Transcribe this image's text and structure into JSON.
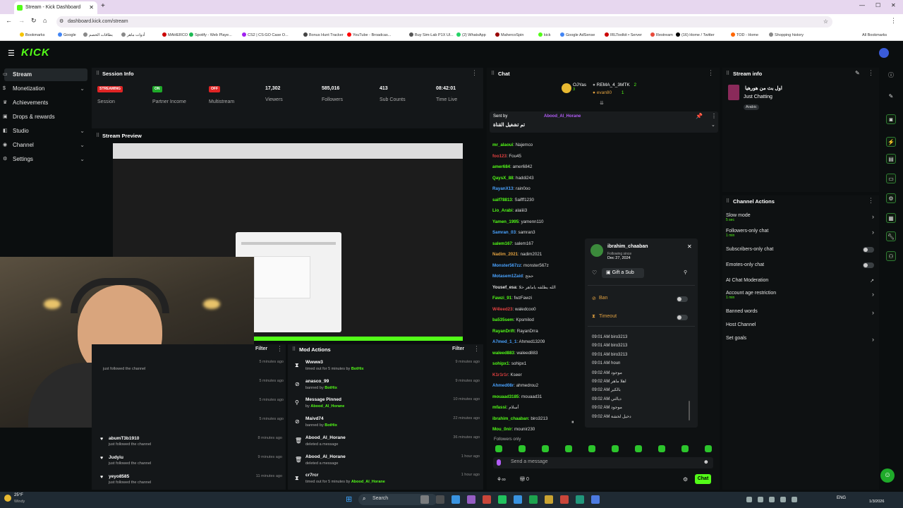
{
  "browser": {
    "tab_title": "Stream - Kick Dashboard",
    "url": "dashboard.kick.com/stream",
    "bookmarks": [
      "Bookmarks",
      "Google",
      "بطاقات الخصم",
      "أدوات ماهر",
      "MAHERCO",
      "Spotify - Web Playe...",
      "CS2 | CS:GO Case O...",
      "Bonus Hunt Tracker",
      "YouTube - Broadcas...",
      "Buy Sim-Lab P1X Ul...",
      "(2) WhatsApp",
      "MahercoSpin",
      "kick",
      "Google AdSense",
      "IRLToolkit • Server",
      "Restream",
      "(16) Home / Twitter",
      "TOD - Home",
      "Shopping history"
    ],
    "all_bookmarks": "All Bookmarks"
  },
  "brand": {
    "logo": "KICK",
    "accent": "#53fc18"
  },
  "sidebar": {
    "items": [
      {
        "label": "Stream",
        "active": true,
        "icon": "stream-icon",
        "chevron": false
      },
      {
        "label": "Monetization",
        "chevron": true,
        "icon": "dollar-icon"
      },
      {
        "label": "Achievements",
        "chevron": false,
        "icon": "trophy-icon"
      },
      {
        "label": "Drops & rewards",
        "chevron": false,
        "icon": "gift-icon"
      },
      {
        "label": "Studio",
        "chevron": true,
        "icon": "studio-icon"
      },
      {
        "label": "Channel",
        "chevron": true,
        "icon": "channel-icon"
      },
      {
        "label": "Settings",
        "chevron": true,
        "icon": "gear-icon"
      }
    ]
  },
  "session_info": {
    "title": "Session Info",
    "stats": [
      {
        "badge": "STREAMING",
        "badge_color": "#e02424",
        "label": "Session"
      },
      {
        "badge": "ON",
        "badge_color": "#1faa2a",
        "label": "Partner Income"
      },
      {
        "badge": "OFF",
        "badge_color": "#e02424",
        "label": "Multistream"
      },
      {
        "value": "17,302",
        "label": "Viewers"
      },
      {
        "value": "585,016",
        "label": "Followers"
      },
      {
        "value": "413",
        "label": "Sub Counts"
      },
      {
        "value": "08:42:01",
        "label": "Time Live"
      }
    ]
  },
  "stream_preview": {
    "title": "Stream Preview"
  },
  "activity_feed": {
    "filter": "Filter",
    "rows": [
      {
        "name": "",
        "sub": "just followed the channel",
        "time": "5 minutes ago"
      },
      {
        "name": "",
        "sub": "",
        "time": "5 minutes ago"
      },
      {
        "name": "",
        "sub": "",
        "time": "5 minutes ago"
      },
      {
        "name": "",
        "sub": "",
        "time": "5 minutes ago"
      },
      {
        "name": "abumT3b1910",
        "sub": "just followed the channel",
        "time": "8 minutes ago"
      },
      {
        "name": "Judyiu",
        "sub": "just followed the channel",
        "time": "9 minutes ago"
      },
      {
        "name": "yeyo8585",
        "sub": "just followed the channel",
        "time": "11 minutes ago"
      }
    ]
  },
  "mod_actions": {
    "title": "Mod Actions",
    "filter": "Filter",
    "rows": [
      {
        "name": "Wwww3",
        "line": "timed out for 5 minutes by ",
        "by": "BotHix",
        "time": "9 minutes ago",
        "icon": "hourglass-icon"
      },
      {
        "name": "anasco_99",
        "line": "banned by ",
        "by": "BotHix",
        "time": "9 minutes ago",
        "icon": "ban-icon"
      },
      {
        "name": "Message Pinned",
        "line": "by ",
        "by": "Abood_Al_Horane",
        "time": "10 minutes ago",
        "icon": "pin-icon"
      },
      {
        "name": "Maivd74",
        "line": "banned by ",
        "by": "BotHix",
        "time": "22 minutes ago",
        "icon": "ban-icon"
      },
      {
        "name": "Abood_Al_Horane",
        "line": "deleted a message",
        "by": "",
        "time": "36 minutes ago",
        "icon": "trash-icon"
      },
      {
        "name": "Abood_Al_Horane",
        "line": "deleted a message",
        "by": "",
        "time": "1 hour ago",
        "icon": "trash-icon"
      },
      {
        "name": "cr7rcr",
        "line": "timed out for 5 minutes by ",
        "by": "Abood_Al_Horane",
        "time": "1 hour ago",
        "icon": "hourglass-icon"
      }
    ]
  },
  "chat": {
    "title": "Chat",
    "leaderboard": [
      {
        "name": "OJYas",
        "count": "3"
      },
      {
        "name": "REMA_4_3MTK",
        "count": "2"
      },
      {
        "name": "evan80",
        "count": "1"
      }
    ],
    "pinned": {
      "sent_by": "Sent by",
      "author": "Abood_Al_Horane",
      "text": "تم تشغيل القناة"
    },
    "messages": [
      {
        "user": "mr_alaoui",
        "text": "Najemco",
        "color": "#53fc18"
      },
      {
        "user": "foo123",
        "text": "Fou45",
        "color": "#e04040"
      },
      {
        "user": "amer684",
        "text": "amer6842",
        "color": "#53fc18"
      },
      {
        "user": "QaysX_88",
        "text": "haddi243",
        "color": "#53fc18"
      },
      {
        "user": "RayanX13",
        "text": "rain0oo",
        "color": "#4aa3ff"
      },
      {
        "user": "saif78813",
        "text": "Saifff1230",
        "color": "#53fc18"
      },
      {
        "user": "Lio_Arabi",
        "text": "alaiiii3",
        "color": "#53fc18"
      },
      {
        "user": "Yamen_1995",
        "text": "yamenn110",
        "color": "#53fc18"
      },
      {
        "user": "Samran_03",
        "text": "samran3",
        "color": "#4aa3ff"
      },
      {
        "user": "salem167",
        "text": "salem167",
        "color": "#53fc18"
      },
      {
        "user": "Nadim_2021",
        "text": "nadim2021",
        "color": "#e0a040"
      },
      {
        "user": "Monster567zz",
        "text": "monster567z",
        "color": "#4aa3ff"
      },
      {
        "user": "Motasem1Zaid",
        "text": "حجج",
        "color": "#4aa3ff"
      },
      {
        "user": "Yousef_esa",
        "text": "الله يطلقه ياماهر خلا",
        "color": "#e6e6e6"
      },
      {
        "user": "Fawzi_91",
        "text": "fwzFawzi",
        "color": "#53fc18"
      },
      {
        "user": "W4leed23",
        "text": "waledcoo0",
        "color": "#e04040"
      },
      {
        "user": "ba535sem",
        "text": "Kpsmilod",
        "color": "#53fc18"
      },
      {
        "user": "RayanDrift",
        "text": "RayanDrra",
        "color": "#53fc18"
      },
      {
        "user": "A7med_1_1",
        "text": "Ahmed13209",
        "color": "#4aa3ff"
      },
      {
        "user": "waleed883",
        "text": "waleed883",
        "color": "#53fc18"
      },
      {
        "user": "sohipx1",
        "text": "sohipx1",
        "color": "#53fc18"
      },
      {
        "user": "K1r1r1r",
        "text": "Kseer",
        "color": "#e04040"
      },
      {
        "user": "Ahmed08r",
        "text": "ahmedrou2",
        "color": "#4aa3ff"
      },
      {
        "user": "mouaad3185",
        "text": "mouaad31",
        "color": "#53fc18"
      },
      {
        "user": "mfassi",
        "text": "أسلام",
        "color": "#53fc18"
      },
      {
        "user": "ibrahim_chaaban",
        "text": "biro3213",
        "color": "#53fc18"
      },
      {
        "user": "Mou_0nir",
        "text": "mounir230",
        "color": "#53fc18"
      }
    ],
    "followers_only": "Followers only",
    "input_placeholder": "Send a message",
    "send_label": "Chat",
    "viewer_count": "0"
  },
  "user_card": {
    "username": "ibrahim_chaaban",
    "following_since": "Following since",
    "following_date": "Dec 27, 2024",
    "gift_label": "Gift a Sub",
    "ban_label": "Ban",
    "timeout_label": "Timeout",
    "history": [
      {
        "time": "09:01 AM",
        "text": "biro3213"
      },
      {
        "time": "09:01 AM",
        "text": "biro3213"
      },
      {
        "time": "09:01 AM",
        "text": "biro3213"
      },
      {
        "time": "09:01 AM",
        "text": "houn"
      },
      {
        "time": "09:02 AM",
        "text": "موجود"
      },
      {
        "time": "09:02 AM",
        "text": "اهلا ماهر"
      },
      {
        "time": "09:02 AM",
        "text": "بالكير"
      },
      {
        "time": "09:02 AM",
        "text": "ديالتي"
      },
      {
        "time": "09:02 AM",
        "text": "موجود"
      },
      {
        "time": "09:02 AM",
        "text": "دخيل لخشة"
      }
    ]
  },
  "stream_info": {
    "title": "Stream info",
    "stream_title": "اول بث من هورهيا",
    "category": "Just Chatting",
    "language": "Arabic"
  },
  "channel_actions": {
    "title": "Channel Actions",
    "rows": [
      {
        "label": "Slow mode",
        "small": "5 sec",
        "control": "arrow"
      },
      {
        "label": "Followers-only chat",
        "small": "1 min",
        "control": "arrow"
      },
      {
        "label": "Subscribers-only chat",
        "small": "",
        "control": "toggle"
      },
      {
        "label": "Emotes-only chat",
        "small": "",
        "control": "toggle"
      },
      {
        "label": "AI Chat Moderation",
        "small": "",
        "control": "external"
      },
      {
        "label": "Account age restriction",
        "small": "1 min",
        "control": "arrow"
      },
      {
        "label": "Banned words",
        "small": "",
        "control": "arrow"
      },
      {
        "label": "Host Channel",
        "small": "",
        "control": "none"
      },
      {
        "label": "Set goals",
        "small": "",
        "control": "arrow"
      }
    ]
  },
  "taskbar": {
    "weather_temp": "25°F",
    "weather_desc": "Windy",
    "search": "Search",
    "lang": "ENG",
    "time": "",
    "date": "1/3/2026"
  }
}
